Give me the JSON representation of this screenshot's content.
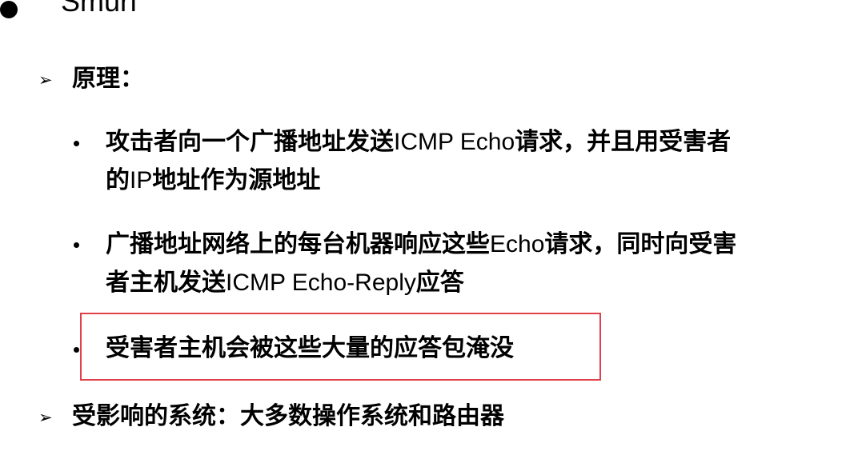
{
  "title": "Smurf",
  "sections": [
    {
      "marker": "➢",
      "heading": "原理："
    },
    {
      "marker": "➢",
      "heading": "受影响的系统：大多数操作系统和路由器"
    }
  ],
  "items": [
    {
      "segments": [
        "攻击者向一个广播地址发送",
        "ICMP Echo",
        "请求，并且用受害者",
        "的",
        "IP",
        "地址作为源地址"
      ]
    },
    {
      "segments": [
        "广播地址网络上的每台机器响应这些",
        "Echo",
        "请求，同时向受害",
        "者主机发送",
        "ICMP Echo-Reply",
        "应答"
      ]
    },
    {
      "segments": [
        "受害者主机会被这些大量的应答包淹没"
      ]
    }
  ],
  "highlight": {
    "color": "#e0404a"
  }
}
